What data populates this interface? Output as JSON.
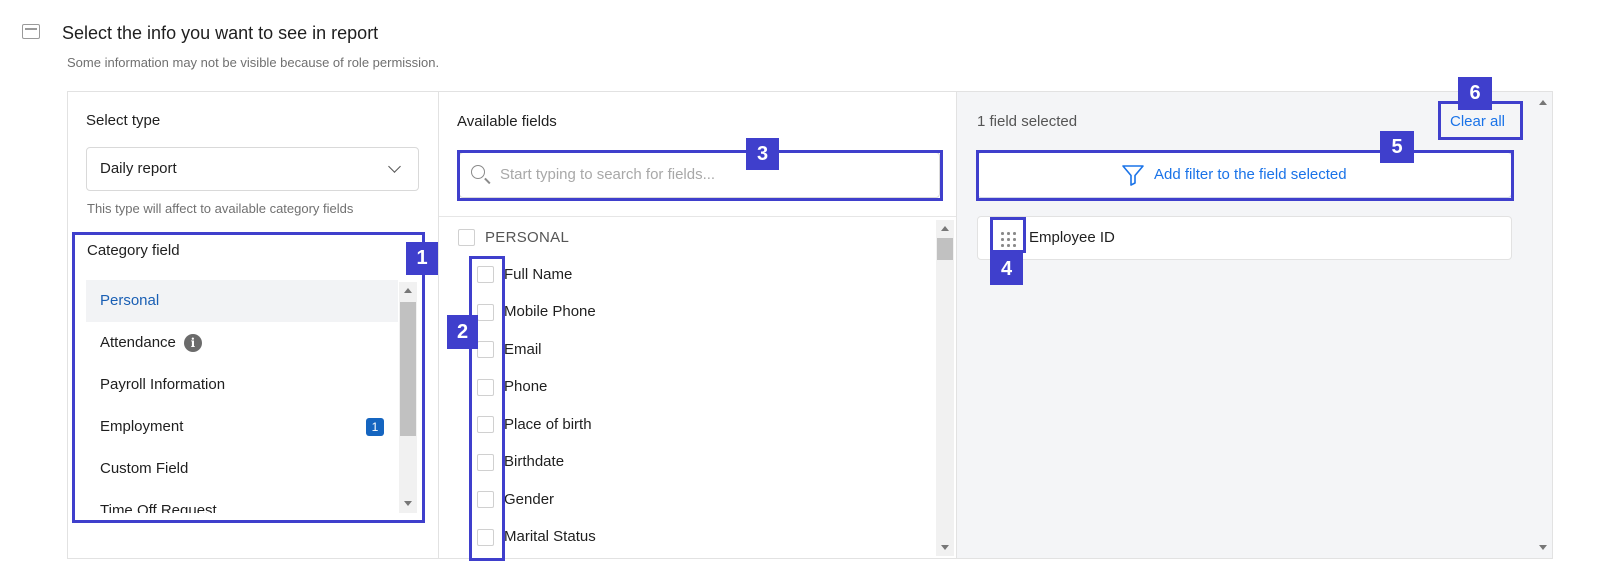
{
  "header": {
    "title": "Select the info you want to see in report",
    "subtitle": "Some information may not be visible because of role permission."
  },
  "left": {
    "title": "Select type",
    "select_value": "Daily report",
    "hint": "This type will affect to available category fields",
    "category_title": "Category field",
    "categories": [
      {
        "label": "Personal"
      },
      {
        "label": "Attendance"
      },
      {
        "label": "Payroll Information"
      },
      {
        "label": "Employment",
        "badge": "1"
      },
      {
        "label": "Custom Field"
      },
      {
        "label": "Time Off Request"
      }
    ],
    "info_glyph": "i"
  },
  "middle": {
    "title": "Available fields",
    "search_placeholder": "Start typing to search for fields...",
    "group": "PERSONAL",
    "fields": [
      "Full Name",
      "Mobile Phone",
      "Email",
      "Phone",
      "Place of birth",
      "Birthdate",
      "Gender",
      "Marital Status"
    ]
  },
  "right": {
    "selected_count_text": "1 field selected",
    "clear_all": "Clear all",
    "filter_label": "Add filter to the field selected",
    "selected_fields": [
      "Employee ID"
    ]
  },
  "annotations": [
    "1",
    "2",
    "3",
    "4",
    "5",
    "6"
  ],
  "colors": {
    "accent": "#1a73e8",
    "annotation": "#3f3fcc",
    "badge": "#1565c0"
  }
}
